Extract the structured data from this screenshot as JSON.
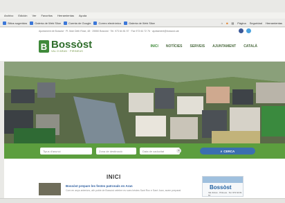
{
  "browser": {
    "menu": [
      "Archivo",
      "Edición",
      "Ver",
      "Favoritos",
      "Herramientas",
      "Ayuda"
    ],
    "favorites": [
      "Sitios sugeridos",
      "Galería de Web Slice",
      "Cuenta de Google",
      "Correo electrónico",
      "Galería de Web Slice"
    ],
    "tools": [
      "Página",
      "Seguridad",
      "Herramientas"
    ]
  },
  "topbar": {
    "contact": "Ajuntament de Bossòst · Pl. Mair Deth Ròse, 48 · 25550 Bossòst · Tel. 973 64 81 57 · Fax 973 64 72 76 · ajuntament@bossost.cat"
  },
  "header": {
    "logo_letter": "B",
    "logo_name": "Bossòst",
    "logo_sub": "VAL D'ARAN · PIRINEUS",
    "nav": [
      "INICI",
      "NOTÍCIES",
      "SERVEIS",
      "AJUNTAMENT",
      "CATALÀ"
    ],
    "nav_active": "INICI"
  },
  "search": {
    "field1": "Tipus d'anunci",
    "field2": "Zona de destinació",
    "field3": "Data de caducitat",
    "button": "CERCA"
  },
  "main": {
    "heading": "INICI",
    "article_title": "Bossòst prepare les festes patronals en Aran",
    "article_text": "Com en anys anteriors, ath poble de Bossòst celebre es sues hèstes Sant Roc e Sant Joan, auem preparat",
    "ad_name": "Bossòst",
    "ad_sub": "Val d'Aran · Pirineus · Tel. 973 64 81 57"
  },
  "colors": {
    "brand_green": "#3f8a3a",
    "search_bar": "#5c9e3e",
    "search_button": "#3b6fb0",
    "link_blue": "#2f5fa0"
  }
}
